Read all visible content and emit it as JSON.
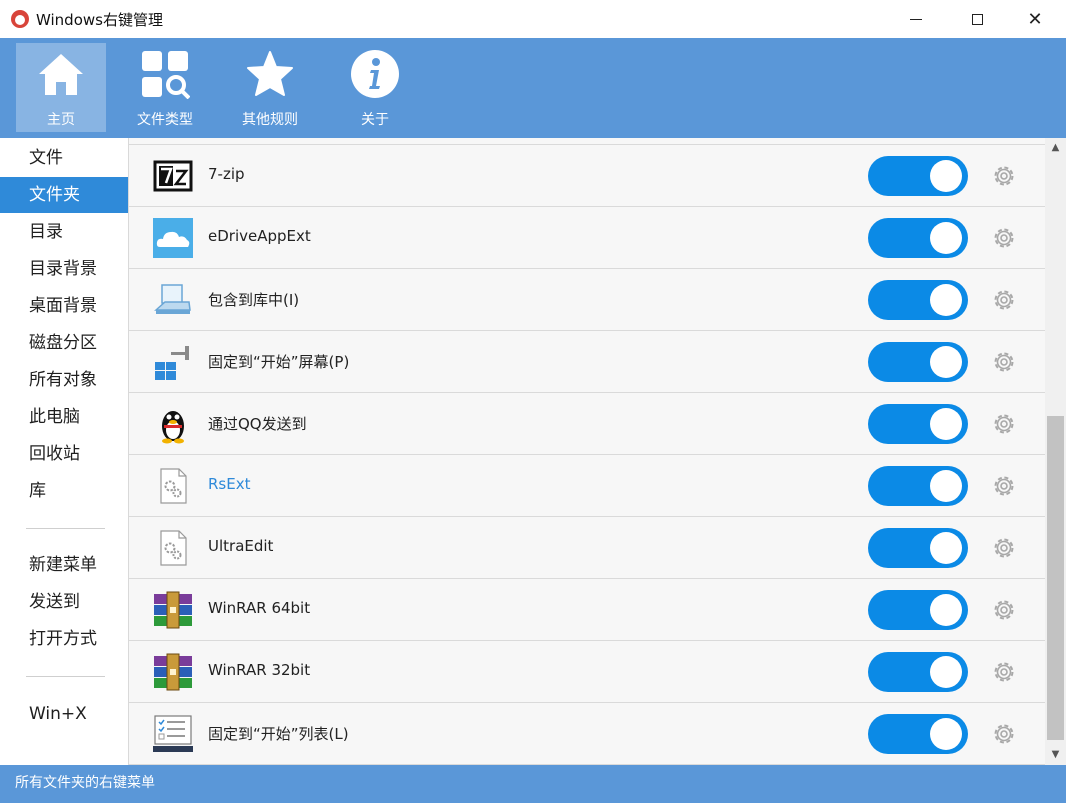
{
  "window": {
    "title": "Windows右键管理",
    "minimize_icon": "minimize-icon",
    "maximize_icon": "maximize-icon",
    "close_glyph": "✕"
  },
  "toolbar": {
    "items": [
      {
        "label": "主页",
        "icon": "home-icon",
        "active": true
      },
      {
        "label": "文件类型",
        "icon": "file-types-icon",
        "active": false
      },
      {
        "label": "其他规则",
        "icon": "star-icon",
        "active": false
      },
      {
        "label": "关于",
        "icon": "info-icon",
        "active": false
      }
    ]
  },
  "sidebar": {
    "items": [
      {
        "label": "文件"
      },
      {
        "label": "文件夹",
        "selected": true
      },
      {
        "label": "目录"
      },
      {
        "label": "目录背景"
      },
      {
        "label": "桌面背景"
      },
      {
        "label": "磁盘分区"
      },
      {
        "label": "所有对象"
      },
      {
        "label": "此电脑"
      },
      {
        "label": "回收站"
      },
      {
        "label": "库"
      },
      {
        "label": "新建菜单"
      },
      {
        "label": "发送到"
      },
      {
        "label": "打开方式"
      },
      {
        "label": "Win+X"
      }
    ]
  },
  "list": {
    "rows": [
      {
        "label": "7-zip",
        "icon": "7zip-icon",
        "enabled": true
      },
      {
        "label": "eDriveAppExt",
        "icon": "cloud-icon",
        "enabled": true
      },
      {
        "label": "包含到库中(I)",
        "icon": "library-icon",
        "enabled": true
      },
      {
        "label": "固定到“开始”屏幕(P)",
        "icon": "pin-start-icon",
        "enabled": true
      },
      {
        "label": "通过QQ发送到",
        "icon": "qq-penguin-icon",
        "enabled": true
      },
      {
        "label": "RsExt",
        "icon": "settings-file-icon",
        "enabled": true,
        "highlighted": true
      },
      {
        "label": "UltraEdit",
        "icon": "settings-file-icon",
        "enabled": true
      },
      {
        "label": "WinRAR 64bit",
        "icon": "winrar-icon",
        "enabled": true
      },
      {
        "label": "WinRAR 32bit",
        "icon": "winrar-icon",
        "enabled": true
      },
      {
        "label": "固定到“开始”列表(L)",
        "icon": "start-list-icon",
        "enabled": true
      }
    ],
    "settings_icon": "gear-icon"
  },
  "scrollbar": {
    "up_glyph": "▲",
    "down_glyph": "▼"
  },
  "status": {
    "text": "所有文件夹的右键菜单"
  },
  "colors": {
    "accent": "#5a97d8",
    "selected": "#2f8ad9",
    "toggle_on": "#0b8ae6"
  }
}
